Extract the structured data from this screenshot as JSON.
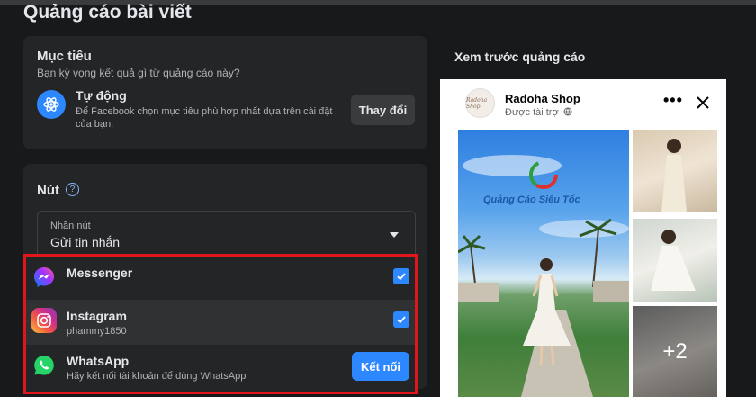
{
  "page": {
    "title": "Quảng cáo bài viết"
  },
  "goal": {
    "title": "Mục tiêu",
    "question": "Bạn kỳ vọng kết quả gì từ quảng cáo này?",
    "option_name": "Tự động",
    "option_desc": "Để Facebook chọn mục tiêu phù hợp nhất dựa trên cài đặt của bạn.",
    "change_button": "Thay đổi",
    "icon": "atom-icon"
  },
  "button_section": {
    "title": "Nút",
    "select_label": "Nhãn nút",
    "select_value": "Gửi tin nhắn"
  },
  "channels": [
    {
      "name": "Messenger",
      "sub": "",
      "checked": true,
      "icon": "messenger-icon"
    },
    {
      "name": "Instagram",
      "sub": "phammy1850",
      "checked": true,
      "icon": "instagram-icon"
    },
    {
      "name": "WhatsApp",
      "sub": "Hãy kết nối tài khoản để dùng WhatsApp",
      "action": "Kết nối",
      "icon": "whatsapp-icon"
    }
  ],
  "preview": {
    "title": "Xem trước quảng cáo",
    "page_name": "Radoha Shop",
    "sponsored": "Được tài trợ",
    "more_count": "+2",
    "watermark": "Quảng Cáo Siêu Tốc",
    "avatar_text": "Radoha Shop"
  },
  "colors": {
    "accent": "#2d88ff",
    "highlight_border": "#e0161b",
    "background": "#18191a",
    "card": "#242526"
  }
}
